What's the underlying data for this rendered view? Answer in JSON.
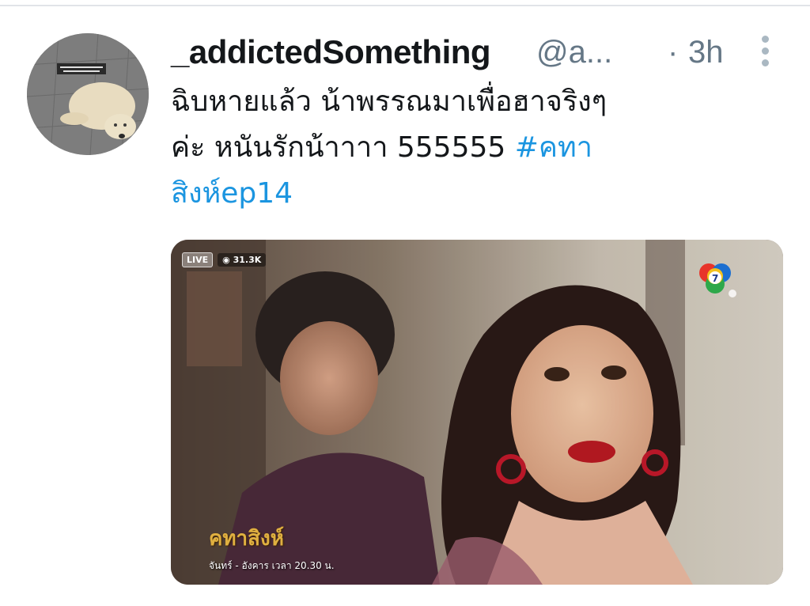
{
  "tweet": {
    "display_name": "_addictedSomething",
    "handle": "@a...",
    "separator": "·",
    "timestamp": "3h",
    "text_lines": [
      "ฉิบหายแล้ว  น้าพรรณมาเพื่อฮาจริงๆ",
      "ค่ะ หนันรักน้าาาา 555555 "
    ],
    "hashtag_part1": "#คทา",
    "hashtag_part2": "สิงห์ep14"
  },
  "media": {
    "live_label": "LIVE",
    "viewer_count": "31.3K",
    "show_title": "คทาสิงห์",
    "schedule_text": "จันทร์ - อังคาร เวลา 20.30 น."
  },
  "icons": {
    "more": "more-vertical-icon",
    "viewers": "eye-icon",
    "channel": "channel-7-logo"
  },
  "colors": {
    "hashtag": "#1b95e0",
    "secondary_text": "#657786",
    "primary_text": "#14171a"
  }
}
